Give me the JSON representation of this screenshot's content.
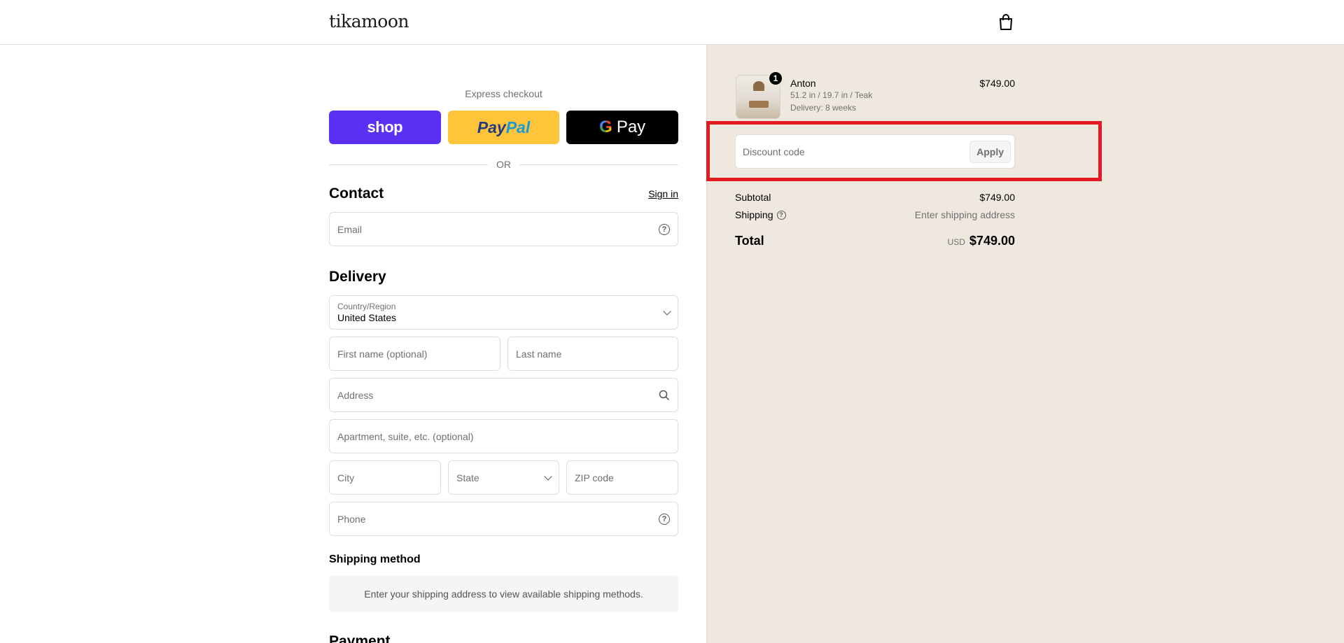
{
  "header": {
    "logo": "tikamoon",
    "cart_icon": "shopping-bag-icon"
  },
  "express": {
    "label": "Express checkout",
    "shop_label": "shop",
    "paypal_part1": "Pay",
    "paypal_part2": "Pal",
    "gpay_g": "G",
    "gpay_label": "Pay",
    "or_label": "OR"
  },
  "contact": {
    "title": "Contact",
    "signin_label": "Sign in",
    "email_placeholder": "Email"
  },
  "delivery": {
    "title": "Delivery",
    "country_label": "Country/Region",
    "country_value": "United States",
    "first_name_placeholder": "First name (optional)",
    "last_name_placeholder": "Last name",
    "address_placeholder": "Address",
    "apartment_placeholder": "Apartment, suite, etc. (optional)",
    "city_placeholder": "City",
    "state_placeholder": "State",
    "zip_placeholder": "ZIP code",
    "phone_placeholder": "Phone"
  },
  "shipping_method": {
    "title": "Shipping method",
    "note": "Enter your shipping address to view available shipping methods."
  },
  "payment": {
    "title": "Payment"
  },
  "summary": {
    "item": {
      "quantity": "1",
      "name": "Anton",
      "spec": "51.2 in / 19.7 in / Teak",
      "delivery": "Delivery: 8 weeks",
      "price": "$749.00"
    },
    "discount_placeholder": "Discount code",
    "apply_label": "Apply",
    "subtotal_label": "Subtotal",
    "subtotal_value": "$749.00",
    "shipping_label": "Shipping",
    "shipping_value": "Enter shipping address",
    "total_label": "Total",
    "total_currency": "USD",
    "total_value": "$749.00"
  },
  "colors": {
    "shop_pay": "#5a31f4",
    "paypal": "#ffc439",
    "gpay": "#000000",
    "summary_bg": "#efe8df",
    "highlight": "#e31b23"
  }
}
